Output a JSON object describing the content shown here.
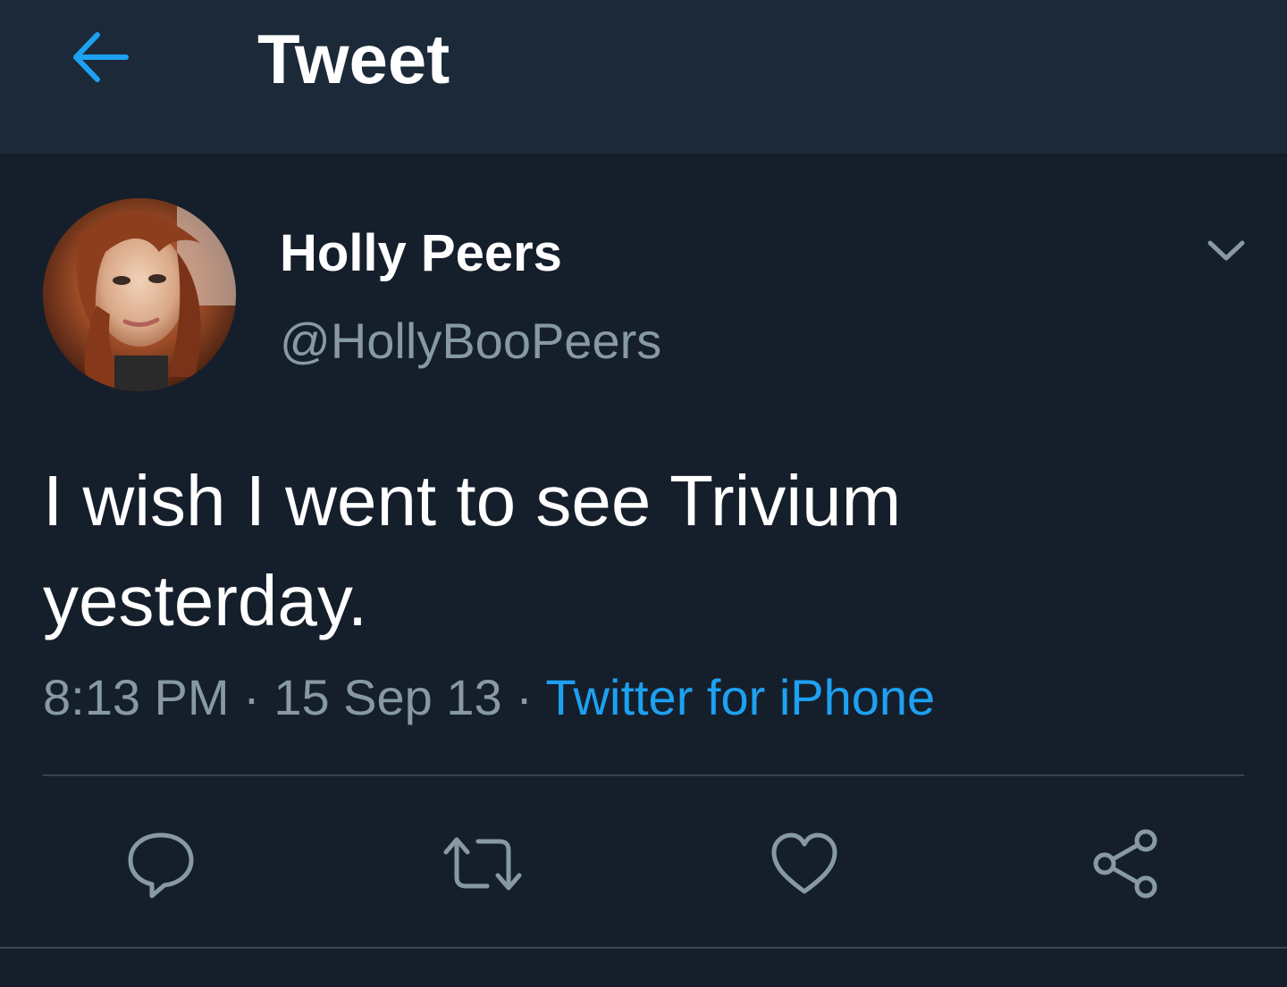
{
  "header": {
    "title": "Tweet",
    "back_icon": "arrow-left-icon",
    "accent_color": "#1da1f2"
  },
  "tweet": {
    "author": {
      "display_name": "Holly Peers",
      "handle": "@HollyBooPeers",
      "avatar": "profile-photo"
    },
    "text_line1": "I wish I went to see Trivium",
    "text_line2": "yesterday.",
    "time": "8:13 PM",
    "separator1": " · ",
    "date": "15 Sep 13",
    "separator2": " · ",
    "source": "Twitter for iPhone",
    "menu_icon": "chevron-down-icon"
  },
  "actions": [
    {
      "icon": "reply-icon"
    },
    {
      "icon": "retweet-icon"
    },
    {
      "icon": "heart-icon"
    },
    {
      "icon": "share-icon"
    }
  ],
  "colors": {
    "background": "#151f2b",
    "header_background": "#1c2938",
    "secondary_text": "#8899a6",
    "link": "#1da1f2",
    "divider": "#38444d"
  }
}
